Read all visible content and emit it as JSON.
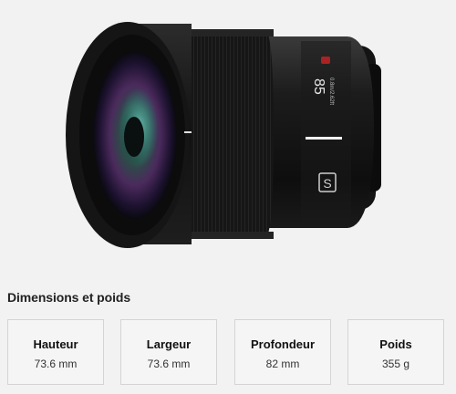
{
  "product": {
    "lens_focal_marking": "85",
    "lens_aperture_marking": "0.8m/2.62ft",
    "lens_series_badge": "S"
  },
  "section": {
    "title": "Dimensions et poids"
  },
  "specs": [
    {
      "label": "Hauteur",
      "value": "73.6 mm"
    },
    {
      "label": "Largeur",
      "value": "73.6 mm"
    },
    {
      "label": "Profondeur",
      "value": "82 mm"
    },
    {
      "label": "Poids",
      "value": "355 g"
    }
  ]
}
